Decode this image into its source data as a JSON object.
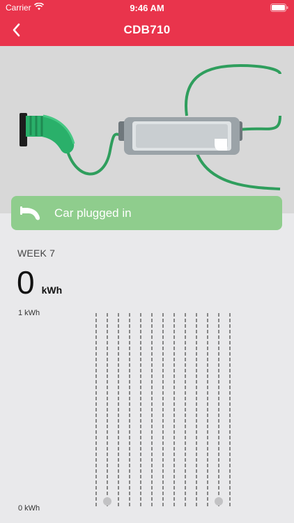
{
  "status_bar": {
    "carrier": "Carrier",
    "time": "9:46 AM"
  },
  "nav": {
    "title": "CDB710"
  },
  "banner": {
    "text": "Car plugged in",
    "color": "#8fcd8d"
  },
  "stats": {
    "week_label": "WEEK 7",
    "energy_value": "0",
    "energy_unit": "kWh"
  },
  "theme": {
    "accent": "#e9344c",
    "cable_color": "#2f9e5d"
  },
  "chart_data": {
    "type": "bar",
    "categories": [
      "",
      "",
      "",
      "",
      "",
      "",
      "",
      "",
      "",
      "",
      "",
      "",
      ""
    ],
    "values": [
      0,
      0,
      0,
      0,
      0,
      0,
      0,
      0,
      0,
      0,
      0,
      0,
      0
    ],
    "markers": [
      1,
      11
    ],
    "ylim": [
      0,
      1
    ],
    "ytick_labels": {
      "top": "1 kWh",
      "bottom": "0 kWh"
    },
    "grid": true
  }
}
